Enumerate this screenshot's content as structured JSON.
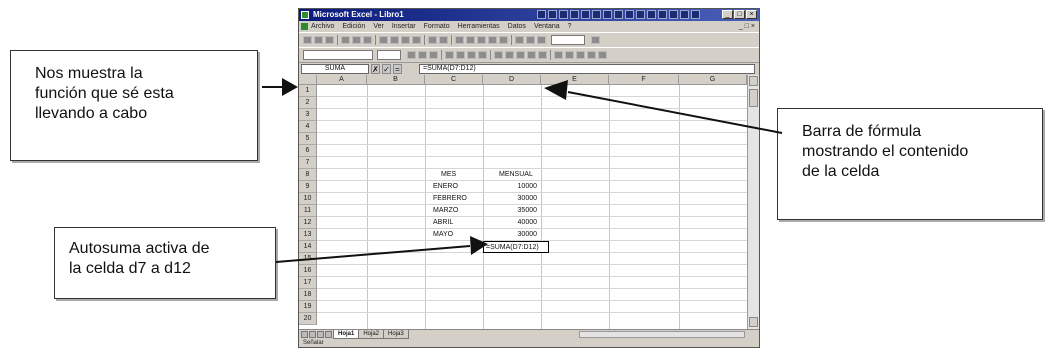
{
  "callouts": {
    "function_note": "Nos muestra la\nfunción que sé esta\nllevando a cabo",
    "formula_bar_note": "Barra de fórmula\nmostrando el contenido\nde la celda",
    "autosum_note": "Autosuma activa de\nla celda d7 a d12"
  },
  "excel": {
    "title": "Microsoft Excel - Libro1",
    "menu": [
      "Archivo",
      "Edición",
      "Ver",
      "Insertar",
      "Formato",
      "Herramientas",
      "Datos",
      "Ventana",
      "?"
    ],
    "name_box": "SUMA",
    "formula_buttons": [
      "✗",
      "✓",
      "="
    ],
    "formula": "=SUMA(D7:D12)",
    "columns": [
      "A",
      "B",
      "C",
      "D",
      "E",
      "F",
      "G"
    ],
    "rows": [
      "1",
      "2",
      "3",
      "4",
      "5",
      "6",
      "7",
      "8",
      "9",
      "10",
      "11",
      "12",
      "13",
      "14",
      "15",
      "16",
      "17",
      "18",
      "19",
      "20"
    ],
    "table": {
      "header_mes": "MES",
      "header_mensual": "MENSUAL",
      "months": [
        "ENERO",
        "FEBRERO",
        "MARZO",
        "ABRIL",
        "MAYO"
      ],
      "amounts": [
        "10000",
        "30000",
        "35000",
        "40000",
        "30000"
      ]
    },
    "active_cell_text": "=SUMA(D7:D12)",
    "sheet_tabs": [
      "Hoja1",
      "Hoja2",
      "Hoja3"
    ],
    "status": "Señalar"
  }
}
